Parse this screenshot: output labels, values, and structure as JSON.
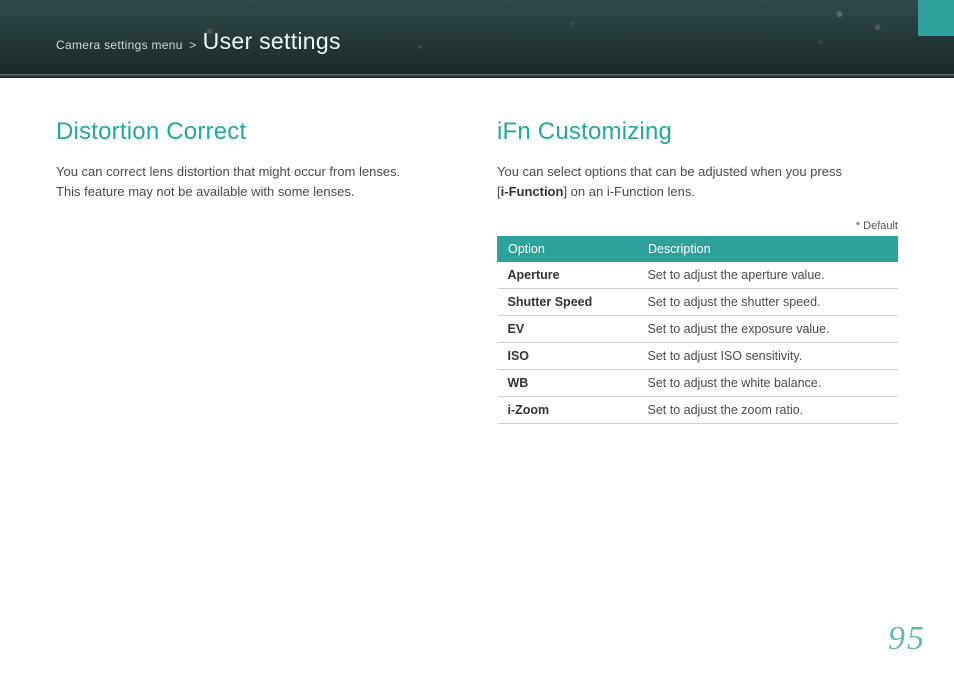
{
  "header": {
    "breadcrumb_prefix": "Camera settings menu",
    "breadcrumb_sep": ">",
    "breadcrumb_title": "User settings"
  },
  "left": {
    "title": "Distortion Correct",
    "p1": "You can correct lens distortion that might occur from lenses.",
    "p2": "This feature may not be available with some lenses."
  },
  "right": {
    "title": "iFn Customizing",
    "p1_a": "You can select options that can be adjusted when you press",
    "p1_b1": "[",
    "p1_bold": "i-Function",
    "p1_b2": "] on an i-Function lens.",
    "default_note": "* Default",
    "table": {
      "head_option": "Option",
      "head_desc": "Description",
      "rows": [
        {
          "option": "Aperture",
          "desc": "Set to adjust the aperture value."
        },
        {
          "option": "Shutter Speed",
          "desc": "Set to adjust the shutter speed."
        },
        {
          "option": "EV",
          "desc": "Set to adjust the exposure value."
        },
        {
          "option": "ISO",
          "desc": "Set to adjust ISO sensitivity."
        },
        {
          "option": "WB",
          "desc": "Set to adjust the white balance."
        },
        {
          "option": "i-Zoom",
          "desc": "Set to adjust the zoom ratio."
        }
      ]
    }
  },
  "page_number": "95",
  "colors": {
    "accent": "#2ea19b"
  }
}
